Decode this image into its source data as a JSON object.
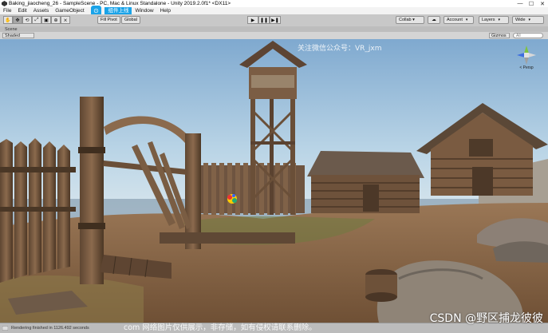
{
  "window": {
    "title": "Baking_jiaocheng_26 - SampleScene - PC, Mac & Linux Standalone - Unity 2019.2.0f1* <DX11>",
    "minimize": "—",
    "maximize": "☐",
    "close": "✕"
  },
  "menu": {
    "items": [
      "File",
      "Edit",
      "Assets",
      "GameObject",
      "Com",
      "组件上线",
      "Window",
      "Help"
    ],
    "highlighted_index": 5
  },
  "toolbar": {
    "tools": [
      "✋",
      "✥",
      "⟲",
      "⤢",
      "▣",
      "⊕",
      "⨯"
    ],
    "pivot_label": "Fill Pivot",
    "global_label": "Global",
    "play": "▶",
    "pause": "❚❚",
    "step": "▶❚",
    "collab_label": "Collab ▾",
    "cloud_icon": "☁",
    "account_label": "Account",
    "layers_label": "Layers",
    "layout_label": "Wide"
  },
  "scene": {
    "tab_label": "Scene",
    "shading_mode": "Shaded",
    "gizmos_label": "Gizmos",
    "search_placeholder": "All",
    "persp_label": "< Persp"
  },
  "viewport": {
    "watermark_text": "关注微信公众号：VR_jxm",
    "sky_color": "#9ec3df",
    "ground_color": "#8a6a4c"
  },
  "status": {
    "message": "Rendering finished in 1126.492 seconds"
  },
  "overlay": {
    "copyright_text": "com 网络图片仅供展示，非存储，如有侵权请联系删除。",
    "csdn_text": "CSDN @野区捕龙彼彼"
  }
}
